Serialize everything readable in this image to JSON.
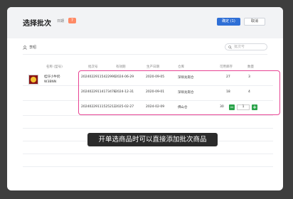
{
  "window": {
    "restore_glyph": "□",
    "close_glyph": "✕"
  },
  "dialog": {
    "title": "选择批次",
    "day_label": "日期",
    "day_chip": "7",
    "confirm_label": "确定 (1)",
    "cancel_label": "取消"
  },
  "toolbar": {
    "user_label": "李昭",
    "search_placeholder": "批次号"
  },
  "table": {
    "headers": [
      "名称 (型号)",
      "批次号",
      "有效期",
      "生产日期",
      "仓库",
      "可用库存",
      "数量"
    ],
    "product": {
      "name_line1": "桂仔小牛奶",
      "name_line2": "W3BNN"
    },
    "rows": [
      {
        "batch": "20240229115422990",
        "expiry": "2024-06-29",
        "production": "2020-09-05",
        "warehouse": "深圳龙岗仓",
        "stock": "27",
        "qty": "3"
      },
      {
        "batch": "20240229114173478",
        "expiry": "2024-12-31",
        "production": "2020-09-01",
        "warehouse": "深圳龙岗仓",
        "stock": "18",
        "qty": "4"
      },
      {
        "batch": "20240229111525212",
        "expiry": "2025-02-27",
        "production": "2024-02-09",
        "warehouse": "佛山仓",
        "stock": "30",
        "qty": "1"
      }
    ]
  },
  "stepper": {
    "minus": "−",
    "plus": "+"
  },
  "toast": "开单选商品时可以直接添加批次商品",
  "colors": {
    "primary": "#2f6fd6",
    "highlight": "#e84393",
    "stepper": "#2aa34a",
    "chip": "#ff8a65"
  }
}
